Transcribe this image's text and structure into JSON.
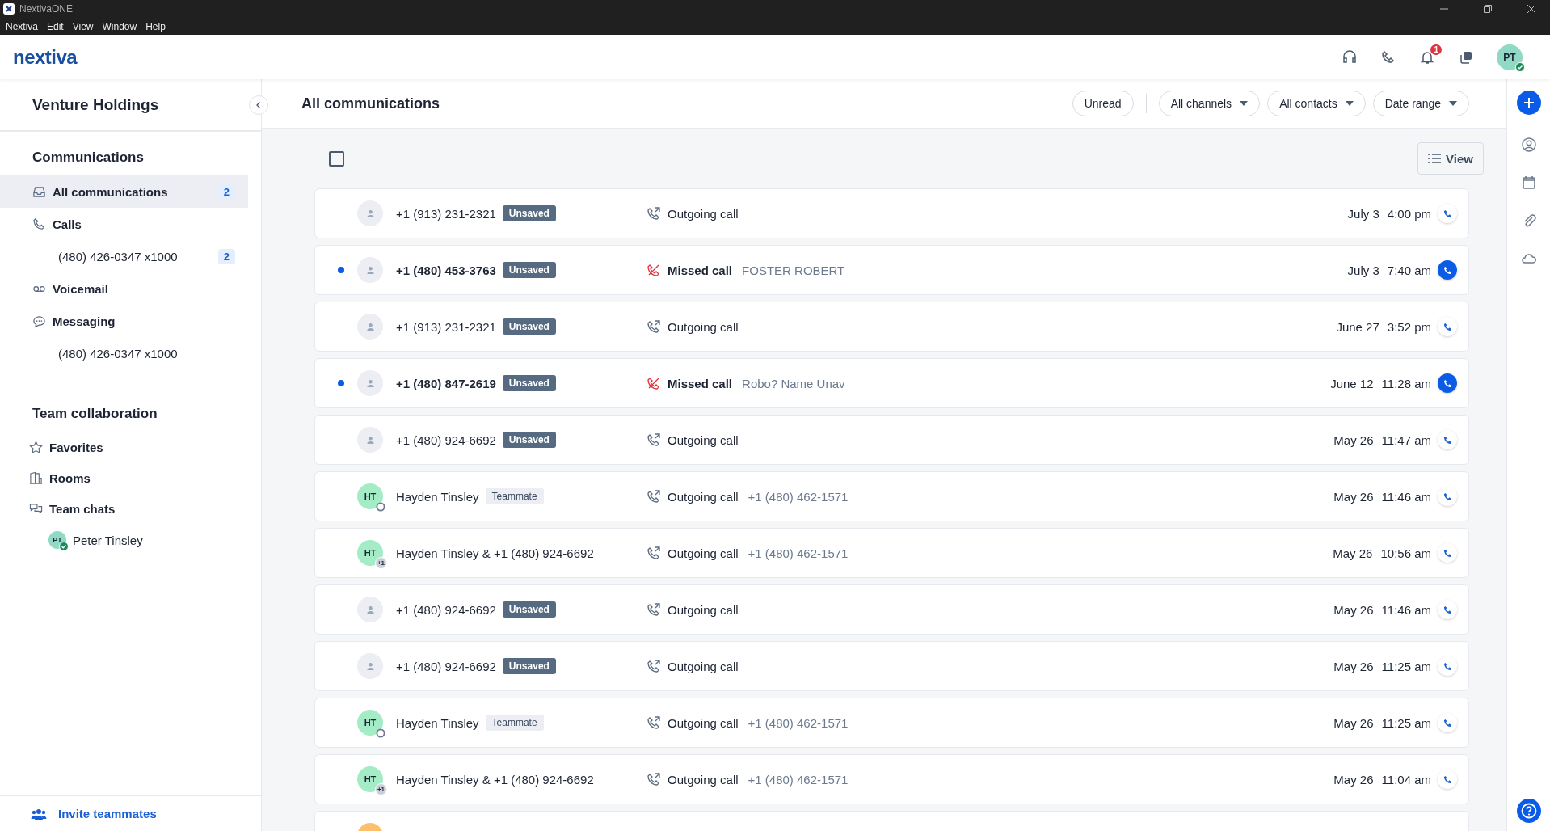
{
  "window": {
    "title": "NextivaONE"
  },
  "menu": [
    "Nextiva",
    "Edit",
    "View",
    "Window",
    "Help"
  ],
  "header": {
    "logo": "nextiva",
    "notifications": "1",
    "user": {
      "initials": "PT",
      "online": true
    }
  },
  "sidebar": {
    "title": "Venture Holdings",
    "sections": [
      {
        "title": "Communications",
        "items": [
          {
            "kind": "inbox",
            "label": "All communications",
            "count": "2",
            "selected": true
          },
          {
            "kind": "phone",
            "label": "Calls",
            "selected": false,
            "children": [
              {
                "label": "(480) 426-0347 x1000",
                "count": "2",
                "selected": false
              }
            ]
          },
          {
            "kind": "voicemail",
            "label": "Voicemail",
            "selected": false
          },
          {
            "kind": "chat",
            "label": "Messaging",
            "selected": false,
            "children": [
              {
                "label": "(480) 426-0347 x1000",
                "selected": false
              }
            ]
          }
        ]
      },
      {
        "title": "Team collaboration",
        "items": [
          {
            "kind": "star",
            "label": "Favorites",
            "selected": false
          },
          {
            "kind": "door",
            "label": "Rooms",
            "selected": false
          },
          {
            "kind": "chats",
            "label": "Team chats",
            "selected": false,
            "children": [
              {
                "label": "Peter Tinsley",
                "avatar": {
                  "initials": "PT",
                  "online": true
                },
                "selected": false
              }
            ]
          }
        ]
      }
    ],
    "footer": "Invite teammates"
  },
  "main": {
    "title": "All communications",
    "filters": [
      {
        "label": "Unread",
        "dropdown": false
      },
      {
        "label": "All channels",
        "dropdown": true
      },
      {
        "label": "All contacts",
        "dropdown": true
      },
      {
        "label": "Date range",
        "dropdown": true
      }
    ],
    "select_all": {
      "checked": false
    },
    "view_button": "View"
  },
  "rows": [
    {
      "unread": false,
      "avatar": {
        "kind": "unknown"
      },
      "contact": "+1 (913) 231-2321",
      "tag": {
        "kind": "unsaved",
        "label": "Unsaved"
      },
      "kind": "outgoing",
      "type_label": "Outgoing call",
      "date": "July 3",
      "time": "4:00 pm"
    },
    {
      "unread": true,
      "avatar": {
        "kind": "unknown"
      },
      "contact": "+1 (480) 453-3763",
      "tag": {
        "kind": "unsaved",
        "label": "Unsaved"
      },
      "kind": "missed",
      "type_label": "Missed call",
      "detail": "FOSTER ROBERT",
      "date": "July 3",
      "time": "7:40 am"
    },
    {
      "unread": false,
      "avatar": {
        "kind": "unknown"
      },
      "contact": "+1 (913) 231-2321",
      "tag": {
        "kind": "unsaved",
        "label": "Unsaved"
      },
      "kind": "outgoing",
      "type_label": "Outgoing call",
      "date": "June 27",
      "time": "3:52 pm"
    },
    {
      "unread": true,
      "avatar": {
        "kind": "unknown"
      },
      "contact": "+1 (480) 847-2619",
      "tag": {
        "kind": "unsaved",
        "label": "Unsaved"
      },
      "kind": "missed",
      "type_label": "Missed call",
      "detail": "Robo? Name Unav",
      "date": "June 12",
      "time": "11:28 am"
    },
    {
      "unread": false,
      "avatar": {
        "kind": "unknown"
      },
      "contact": "+1 (480) 924-6692",
      "tag": {
        "kind": "unsaved",
        "label": "Unsaved"
      },
      "kind": "outgoing",
      "type_label": "Outgoing call",
      "date": "May 26",
      "time": "11:47 am"
    },
    {
      "unread": false,
      "avatar": {
        "kind": "initials",
        "initials": "HT",
        "online": false
      },
      "contact": "Hayden Tinsley",
      "tag": {
        "kind": "teammate",
        "label": "Teammate"
      },
      "kind": "outgoing",
      "type_label": "Outgoing call",
      "detail": "+1 (480) 462-1571",
      "date": "May 26",
      "time": "11:46 am"
    },
    {
      "unread": false,
      "avatar": {
        "kind": "initials",
        "initials": "HT",
        "badge": "+1"
      },
      "contact": "Hayden Tinsley & +1 (480) 924-6692",
      "kind": "outgoing",
      "type_label": "Outgoing call",
      "detail": "+1 (480) 462-1571",
      "date": "May 26",
      "time": "10:56 am"
    },
    {
      "unread": false,
      "avatar": {
        "kind": "unknown"
      },
      "contact": "+1 (480) 924-6692",
      "tag": {
        "kind": "unsaved",
        "label": "Unsaved"
      },
      "kind": "outgoing",
      "type_label": "Outgoing call",
      "date": "May 26",
      "time": "11:46 am"
    },
    {
      "unread": false,
      "avatar": {
        "kind": "unknown"
      },
      "contact": "+1 (480) 924-6692",
      "tag": {
        "kind": "unsaved",
        "label": "Unsaved"
      },
      "kind": "outgoing",
      "type_label": "Outgoing call",
      "date": "May 26",
      "time": "11:25 am"
    },
    {
      "unread": false,
      "avatar": {
        "kind": "initials",
        "initials": "HT",
        "online": false
      },
      "contact": "Hayden Tinsley",
      "tag": {
        "kind": "teammate",
        "label": "Teammate"
      },
      "kind": "outgoing",
      "type_label": "Outgoing call",
      "detail": "+1 (480) 462-1571",
      "date": "May 26",
      "time": "11:25 am"
    },
    {
      "unread": false,
      "avatar": {
        "kind": "initials",
        "initials": "HT",
        "badge": "+1"
      },
      "contact": "Hayden Tinsley & +1 (480) 924-6692",
      "kind": "outgoing",
      "type_label": "Outgoing call",
      "detail": "+1 (480) 462-1571",
      "date": "May 26",
      "time": "11:04 am"
    },
    {
      "avatar": {
        "kind": "orange"
      }
    }
  ]
}
